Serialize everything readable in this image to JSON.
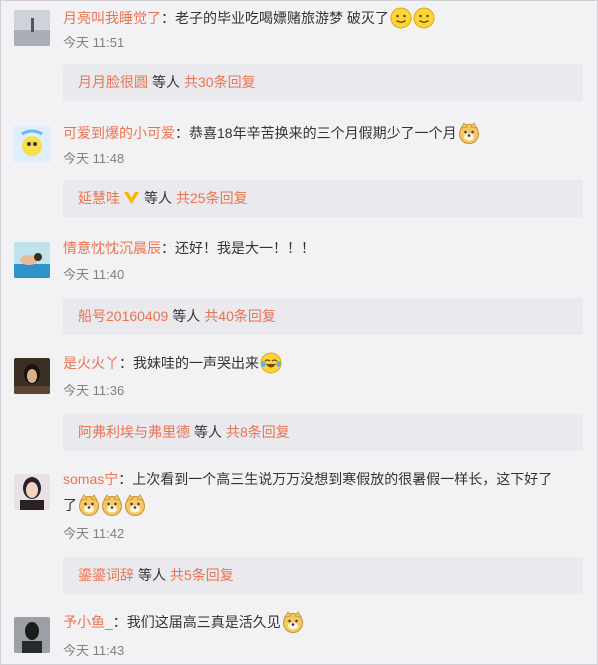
{
  "comments": [
    {
      "user": "月亮叫我睡觉了",
      "sep": "：",
      "text": "老子的毕业吃喝嫖赌旅游梦 破灭了",
      "emojis": [
        "smile-emoji",
        "smile-emoji"
      ],
      "time": "今天 11:51",
      "reply": {
        "user": "月月脸很圆",
        "mid": "等人",
        "count": "共30条回复",
        "badge": false
      }
    },
    {
      "user": "可爱到爆的小可爱",
      "sep": "：",
      "text": "恭喜18年辛苦换来的三个月假期少了一个月",
      "emojis": [
        "doge-emoji"
      ],
      "time": "今天 11:48",
      "reply": {
        "user": "延慧哇",
        "mid": "等人",
        "count": "共25条回复",
        "badge": true
      }
    },
    {
      "user": "情意忱忱沉晨辰",
      "sep": "：",
      "text": "还好！我是大一！！！",
      "emojis": [],
      "time": "今天 11:40",
      "reply": {
        "user": "船号20160409",
        "mid": "等人",
        "count": "共40条回复",
        "badge": false
      }
    },
    {
      "user": "是火火丫",
      "sep": "：",
      "text": "我妹哇的一声哭出来",
      "emojis": [
        "crying-laugh-emoji"
      ],
      "time": "今天 11:36",
      "reply": {
        "user": "阿弗利埃与弗里德",
        "mid": "等人",
        "count": "共8条回复",
        "badge": false
      }
    },
    {
      "user": "somas宁",
      "sep": "：",
      "text": "上次看到一个高三生说万万没想到寒假放的很暑假一样长，这下好了",
      "text2": "了",
      "emojis": [
        "doge-emoji",
        "doge-emoji",
        "doge-emoji"
      ],
      "time": "今天 11:42",
      "reply": {
        "user": "鎏鎏词辞",
        "mid": "等人",
        "count": "共5条回复",
        "badge": false
      }
    },
    {
      "user": "予小鱼_",
      "sep": "：",
      "text": "我们这届高三真是活久见",
      "emojis": [
        "doge-emoji"
      ],
      "time": "今天 11:43"
    }
  ],
  "colors": {
    "username": "#eb7350",
    "text": "#333333",
    "time": "#808080",
    "reply_bg": "#e9e9ee"
  }
}
